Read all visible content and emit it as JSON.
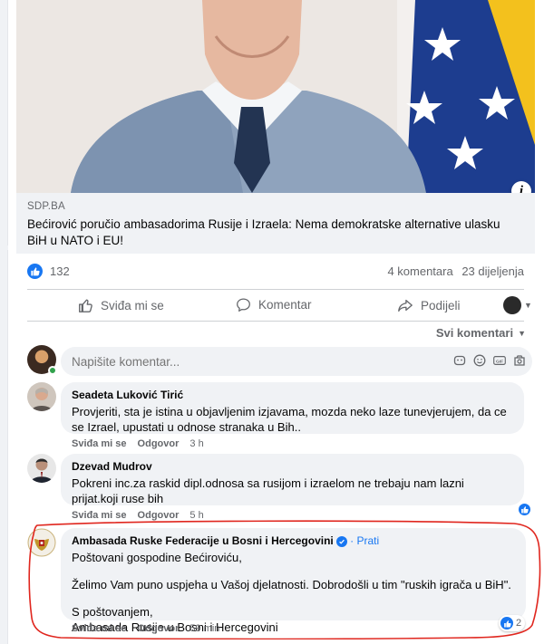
{
  "post": {
    "link_source": "SDP.BA",
    "link_title": "Bećirović poručio ambasadorima Rusije i Izraela: Nema demokratske alternative ulasku BiH u NATO i EU!",
    "info_glyph": "i"
  },
  "reactions": {
    "like_count": "132",
    "comments_count": "4 komentara",
    "shares_count": "23 dijeljenja"
  },
  "actions": {
    "like_label": "Sviđa mi se",
    "comment_label": "Komentar",
    "share_label": "Podijeli"
  },
  "sort": {
    "label": "Svi komentari"
  },
  "composer": {
    "placeholder": "Napišite komentar..."
  },
  "comments": [
    {
      "author": "Seadeta Luković Tirić",
      "text": "Provjeriti, sta je istina u objavljenim izjavama, mozda neko laze tunevjerujem, da ce se Izrael, upustati u odnose stranaka u Bih..",
      "like": "Sviđa mi se",
      "reply": "Odgovor",
      "time": "3 h"
    },
    {
      "author": "Dzevad Mudrov",
      "text": "Pokreni inc.za raskid dipl.odnosa sa rusijom i izraelom ne trebaju nam lazni prijat.koji ruse bih",
      "like": "Sviđa mi se",
      "reply": "Odgovor",
      "time": "5 h"
    },
    {
      "author": "Ambasada Ruske Federacije u Bosni i Hercegovini",
      "follow": "· Prati",
      "para1": "Poštovani gospodine Bećiroviću,",
      "para2": "Želimo Vam puno uspjeha u Vašoj djelatnosti. Dobrodošli u tim \"ruskih igrača u BiH\".",
      "para3_line1": "S poštovanjem,",
      "para3_line2": "Ambasada Rusije u Bosni i Hercegovini",
      "like": "Sviđa mi se",
      "reply": "Odgovor",
      "time": "59 min",
      "reaction_count": "2"
    }
  ],
  "colors": {
    "accent": "#1877f2",
    "highlight_outline": "#e0261e",
    "bubble_bg": "#f0f2f5",
    "muted_text": "#65676b"
  },
  "icons": [
    "info-icon",
    "like-icon",
    "thumbs-up-outline-icon",
    "comment-icon",
    "share-icon",
    "chevron-down-icon",
    "sticker-icon",
    "emoji-icon",
    "gif-icon",
    "camera-icon",
    "verified-icon"
  ]
}
